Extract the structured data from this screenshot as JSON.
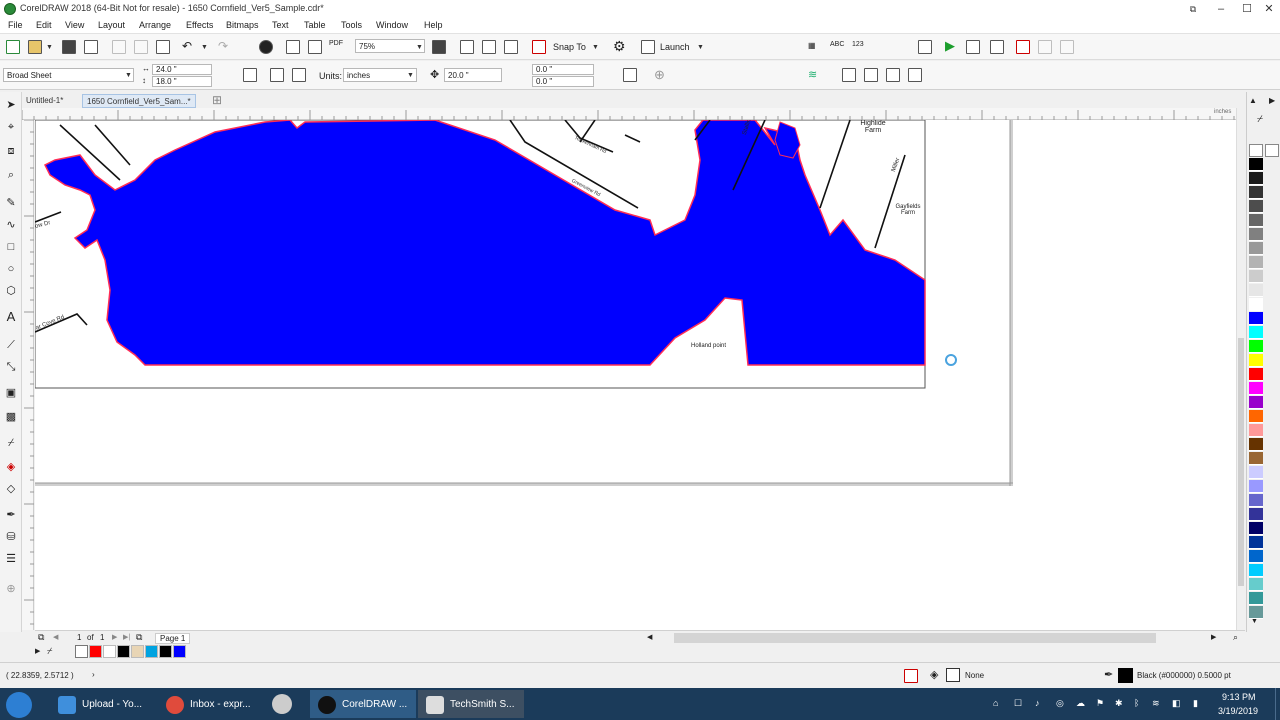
{
  "window": {
    "title": "CorelDRAW 2018 (64-Bit Not for resale) - 1650 Cornfield_Ver5_Sample.cdr*"
  },
  "menu": [
    "File",
    "Edit",
    "View",
    "Layout",
    "Arrange",
    "Effects",
    "Bitmaps",
    "Text",
    "Table",
    "Tools",
    "Window",
    "Help"
  ],
  "toolbar": {
    "zoom": "75%",
    "snap_label": "Snap To",
    "launch_label": "Launch"
  },
  "property_bar": {
    "page_size": "Broad Sheet",
    "width": "24.0 \"",
    "height": "18.0 \"",
    "units_label": "Units:",
    "units": "inches",
    "nudge": "20.0 \"",
    "dup_x": "0.0 \"",
    "dup_y": "0.0 \""
  },
  "doc_tabs": [
    "Untitled-1*",
    "1650 Cornfield_Ver5_Sam...*"
  ],
  "ruler": {
    "unit": "inches"
  },
  "map": {
    "labels": [
      "Highlide Farm",
      "Gayfields Farm",
      "Holland point",
      "Miller",
      "Stallin",
      "Teickenham Rd",
      "Greenview Rd",
      "ow Dr",
      "ar Cove Rd"
    ]
  },
  "page_nav": {
    "current": "1",
    "of": "of",
    "total": "1",
    "page_tab": "Page 1"
  },
  "status": {
    "coords": "( 22.8359, 2.5712 )",
    "fill_none": "None",
    "outline": "Black (#000000)  0.5000 pt"
  },
  "taskbar": {
    "items": [
      "Upload - Yo...",
      "Inbox - expr...",
      "CorelDRAW ...",
      "TechSmith S..."
    ],
    "time": "9:13 PM",
    "date": "3/19/2019"
  },
  "colors": {
    "water": "#0000ff",
    "shore": "#ff2d55",
    "palette": [
      "#000000",
      "#1a1a1a",
      "#333333",
      "#4d4d4d",
      "#666666",
      "#808080",
      "#999999",
      "#b3b3b3",
      "#cccccc",
      "#e6e6e6",
      "#ffffff",
      "#0000ff",
      "#00ffff",
      "#00ff00",
      "#ffff00",
      "#ff0000",
      "#ff00ff",
      "#9900cc",
      "#ff6600",
      "#ff9999",
      "#663300",
      "#996633",
      "#ccccff",
      "#9999ff",
      "#6666cc",
      "#333399",
      "#000066",
      "#003399",
      "#0066cc",
      "#00ccff",
      "#66cccc",
      "#339999",
      "#669999"
    ],
    "doc_palette": [
      "#ff0000",
      "#ffffff",
      "#000000",
      "#e8d5b5",
      "#00a3e0",
      "#000000",
      "#0000ff"
    ]
  }
}
